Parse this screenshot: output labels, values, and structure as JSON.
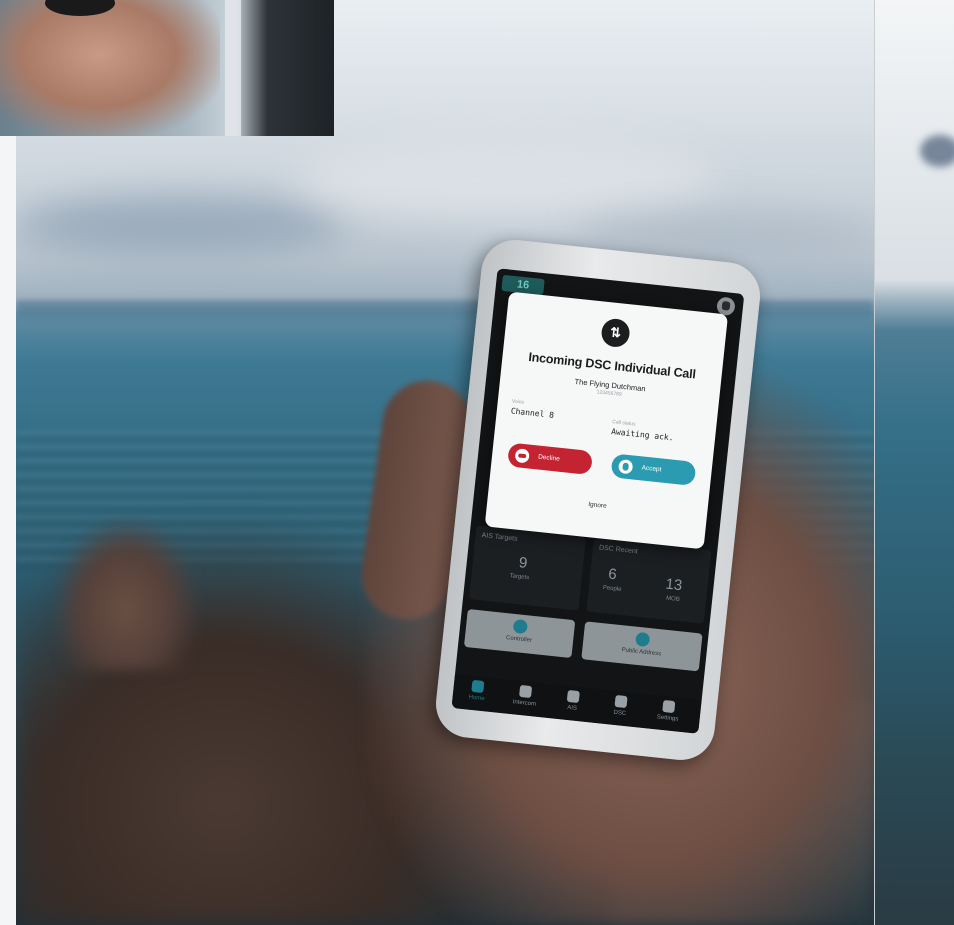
{
  "colors": {
    "decline": "#c42432",
    "accept": "#2a9bb1",
    "modal_bg": "#f6f7f7",
    "screen_bg": "#121416",
    "accent": "#1f7c8d"
  },
  "status_chip": "16",
  "modal": {
    "icon": "⇅",
    "title": "Incoming DSC Individual Call",
    "caller_name": "The Flying Dutchman",
    "caller_id": "123456789",
    "field_left_label": "Voice",
    "field_left_value": "Channel 8",
    "field_right_label": "Call status",
    "field_right_value": "Awaiting ack.",
    "decline_label": "Decline",
    "accept_label": "Accept",
    "ignore_label": "Ignore"
  },
  "dashboard": {
    "targets_label": "AIS Targets",
    "targets_count": "9",
    "targets_unit": "Targets",
    "presets_label": "DSC Recent",
    "presets_count": "6",
    "presets_unit": "People",
    "mob_count": "13",
    "mob_unit": "MOB",
    "controller_label": "Controller",
    "pa_label": "Public Address"
  },
  "nav": [
    "Home",
    "Intercom",
    "AIS",
    "DSC",
    "Settings"
  ]
}
